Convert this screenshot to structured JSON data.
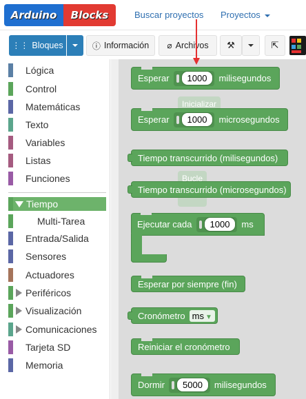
{
  "nav": {
    "logo_part1": "Arduino",
    "logo_part2": "Blocks",
    "search_projects": "Buscar proyectos",
    "projects": "Proyectos"
  },
  "toolbar": {
    "blocks": "Bloques",
    "info": "Información",
    "files": "Archivos"
  },
  "categories": [
    {
      "label": "Lógica",
      "color": "#5b80a5"
    },
    {
      "label": "Control",
      "color": "#5ba55b"
    },
    {
      "label": "Matemáticas",
      "color": "#5b67a5"
    },
    {
      "label": "Texto",
      "color": "#5ba58c"
    },
    {
      "label": "Variables",
      "color": "#a55b80"
    },
    {
      "label": "Listas",
      "color": "#a55b80"
    },
    {
      "label": "Funciones",
      "color": "#995ba5"
    },
    {
      "label": "Tiempo",
      "color": "#5ba55b"
    },
    {
      "label": "Multi-Tarea",
      "color": "#5ba55b"
    },
    {
      "label": "Entrada/Salida",
      "color": "#5b67a5"
    },
    {
      "label": "Sensores",
      "color": "#5b67a5"
    },
    {
      "label": "Actuadores",
      "color": "#a5745b"
    },
    {
      "label": "Periféricos",
      "color": "#5ba55b"
    },
    {
      "label": "Visualización",
      "color": "#5ba55b"
    },
    {
      "label": "Comunicaciones",
      "color": "#5ba58c"
    },
    {
      "label": "Tarjeta SD",
      "color": "#995ba5"
    },
    {
      "label": "Memoria",
      "color": "#5b67a5"
    }
  ],
  "blocks": {
    "wait_ms_label": "Esperar",
    "wait_ms_value": "1000",
    "wait_ms_unit": "milisegundos",
    "wait_us_label": "Esperar",
    "wait_us_value": "1000",
    "wait_us_unit": "microsegundos",
    "elapsed_ms": "Tiempo transcurrido (milisegundos)",
    "elapsed_us": "Tiempo transcurrido (microsegundos)",
    "every_label": "Ejecutar cada",
    "every_value": "1000",
    "every_unit": "ms",
    "wait_forever": "Esperar por siempre (fin)",
    "stopwatch_label": "Cronómetro",
    "stopwatch_unit": "ms",
    "reset_stopwatch": "Reiniciar el cronómetro",
    "sleep_label": "Dormir",
    "sleep_value": "5000",
    "sleep_unit": "milisegundos"
  },
  "ghosts": {
    "init": "Inicializar",
    "loop": "Bucle"
  }
}
